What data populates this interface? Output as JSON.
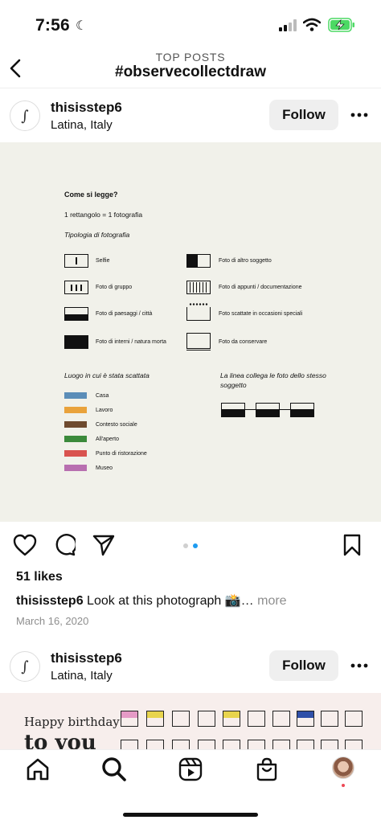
{
  "status": {
    "time": "7:56"
  },
  "header": {
    "subtitle": "TOP POSTS",
    "title": "#observecollectdraw"
  },
  "post1": {
    "username": "thisisstep6",
    "location": "Latina, Italy",
    "follow_label": "Follow",
    "image": {
      "title": "Come si legge?",
      "rule": "1 rettangolo = 1 fotografia",
      "typology_title": "Tipologia di fotografia",
      "types_left": [
        "Selfie",
        "Foto di gruppo",
        "Foto di paesaggi / città",
        "Foto di interni / natura morta"
      ],
      "types_right": [
        "Foto di altro soggetto",
        "Foto di appunti / documentazione",
        "Foto scattate in occasioni speciali",
        "Foto da conservare"
      ],
      "places_title": "Luogo in cui è stata scattata",
      "places": [
        {
          "label": "Casa",
          "color": "#5b8db8"
        },
        {
          "label": "Lavoro",
          "color": "#e9a23b"
        },
        {
          "label": "Contesto sociale",
          "color": "#6e4a2e"
        },
        {
          "label": "All'aperto",
          "color": "#3b8a3b"
        },
        {
          "label": "Punto di ristorazione",
          "color": "#d9534f"
        },
        {
          "label": "Museo",
          "color": "#b86fb0"
        }
      ],
      "line_title": "La linea collega le foto dello stesso soggetto"
    },
    "likes": "51 likes",
    "caption_user": "thisisstep6",
    "caption_text": "Look at this photograph 📸…",
    "caption_more": "more",
    "date": "March 16, 2020",
    "carousel": {
      "active_index": 1,
      "count": 2,
      "active_color": "#1d9bf0",
      "inactive_color": "#d0d0d0"
    }
  },
  "post2": {
    "username": "thisisstep6",
    "location": "Latina, Italy",
    "follow_label": "Follow",
    "image_text_1": "Happy birthday",
    "image_text_2": "to you"
  },
  "tabs": [
    "home-icon",
    "search-icon",
    "reels-icon",
    "shop-icon",
    "profile-avatar"
  ]
}
